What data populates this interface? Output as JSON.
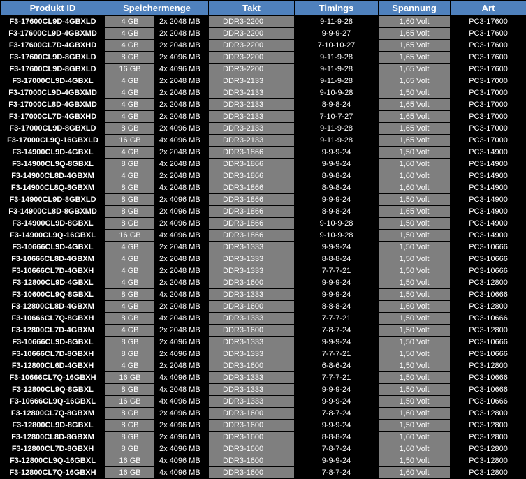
{
  "header": {
    "produkt_id": "Produkt ID",
    "speichermenge": "Speichermenge",
    "takt": "Takt",
    "timings": "Timings",
    "spannung": "Spannung",
    "art": "Art"
  },
  "rows": [
    [
      "F3-17600CL9D-4GBXLD",
      "4 GB",
      "2x 2048 MB",
      "DDR3-2200",
      "9-11-9-28",
      "1,60 Volt",
      "PC3-17600"
    ],
    [
      "F3-17600CL9D-4GBXMD",
      "4 GB",
      "2x 2048 MB",
      "DDR3-2200",
      "9-9-9-27",
      "1,65 Volt",
      "PC3-17600"
    ],
    [
      "F3-17600CL7D-4GBXHD",
      "4 GB",
      "2x 2048 MB",
      "DDR3-2200",
      "7-10-10-27",
      "1,65 Volt",
      "PC3-17600"
    ],
    [
      "F3-17600CL9D-8GBXLD",
      "8 GB",
      "2x 4096 MB",
      "DDR3-2200",
      "9-11-9-28",
      "1,65 Volt",
      "PC3-17600"
    ],
    [
      "F3-17600CL9D-8GBXLD",
      "16 GB",
      "4x 4096 MB",
      "DDR3-2200",
      "9-11-9-28",
      "1,65 Volt",
      "PC3-17600"
    ],
    [
      "F3-17000CL9D-4GBXL",
      "4 GB",
      "2x 2048 MB",
      "DDR3-2133",
      "9-11-9-28",
      "1,65 Volt",
      "PC3-17000"
    ],
    [
      "F3-17000CL9D-4GBXMD",
      "4 GB",
      "2x 2048 MB",
      "DDR3-2133",
      "9-10-9-28",
      "1,50 Volt",
      "PC3-17000"
    ],
    [
      "F3-17000CL8D-4GBXMD",
      "4 GB",
      "2x 2048 MB",
      "DDR3-2133",
      "8-9-8-24",
      "1,65 Volt",
      "PC3-17000"
    ],
    [
      "F3-17000CL7D-4GBXHD",
      "4 GB",
      "2x 2048 MB",
      "DDR3-2133",
      "7-10-7-27",
      "1,65 Volt",
      "PC3-17000"
    ],
    [
      "F3-17000CL9D-8GBXLD",
      "8 GB",
      "2x 4096 MB",
      "DDR3-2133",
      "9-11-9-28",
      "1,65 Volt",
      "PC3-17000"
    ],
    [
      "F3-17000CL9Q-16GBXLD",
      "16 GB",
      "4x 4096 MB",
      "DDR3-2133",
      "9-11-9-28",
      "1,65 Volt",
      "PC3-17000"
    ],
    [
      "F3-14900CL9D-4GBXL",
      "4 GB",
      "2x 2048 MB",
      "DDR3-1866",
      "9-9-9-24",
      "1,50 Volt",
      "PC3-14900"
    ],
    [
      "F3-14900CL9Q-8GBXL",
      "8 GB",
      "4x 2048 MB",
      "DDR3-1866",
      "9-9-9-24",
      "1,60 Volt",
      "PC3-14900"
    ],
    [
      "F3-14900CL8D-4GBXM",
      "4 GB",
      "2x 2048 MB",
      "DDR3-1866",
      "8-9-8-24",
      "1,60 Volt",
      "PC3-14900"
    ],
    [
      "F3-14900CL8Q-8GBXM",
      "8 GB",
      "4x 2048 MB",
      "DDR3-1866",
      "8-9-8-24",
      "1,60 Volt",
      "PC3-14900"
    ],
    [
      "F3-14900CL9D-8GBXLD",
      "8 GB",
      "2x 4096 MB",
      "DDR3-1866",
      "9-9-9-24",
      "1,50 Volt",
      "PC3-14900"
    ],
    [
      "F3-14900CL8D-8GBXMD",
      "8 GB",
      "2x 4096 MB",
      "DDR3-1866",
      "8-9-8-24",
      "1,65 Volt",
      "PC3-14900"
    ],
    [
      "F3-14900CL9D-8GBXL",
      "8 GB",
      "2x 4096 MB",
      "DDR3-1866",
      "9-10-9-28",
      "1,50 Volt",
      "PC3-14900"
    ],
    [
      "F3-14900CL9Q-16GBXL",
      "16 GB",
      "4x 4096 MB",
      "DDR3-1866",
      "9-10-9-28",
      "1,50 Volt",
      "PC3-14900"
    ],
    [
      "F3-10666CL9D-4GBXL",
      "4 GB",
      "2x 2048 MB",
      "DDR3-1333",
      "9-9-9-24",
      "1,50 Volt",
      "PC3-10666"
    ],
    [
      "F3-10666CL8D-4GBXM",
      "4 GB",
      "2x 2048 MB",
      "DDR3-1333",
      "8-8-8-24",
      "1,50 Volt",
      "PC3-10666"
    ],
    [
      "F3-10666CL7D-4GBXH",
      "4 GB",
      "2x 2048 MB",
      "DDR3-1333",
      "7-7-7-21",
      "1,50 Volt",
      "PC3-10666"
    ],
    [
      "F3-12800CL9D-4GBXL",
      "4 GB",
      "2x 2048 MB",
      "DDR3-1600",
      "9-9-9-24",
      "1,50 Volt",
      "PC3-12800"
    ],
    [
      "F3-10600CL9Q-8GBXL",
      "8 GB",
      "4x 2048 MB",
      "DDR3-1333",
      "9-9-9-24",
      "1,50 Volt",
      "PC3-10666"
    ],
    [
      "F3-12800CL8D-4GBXM",
      "4 GB",
      "2x 2048 MB",
      "DDR3-1600",
      "8-8-8-24",
      "1,60 Volt",
      "PC3-12800"
    ],
    [
      "F3-10666CL7Q-8GBXH",
      "8 GB",
      "4x 2048 MB",
      "DDR3-1333",
      "7-7-7-21",
      "1,50 Volt",
      "PC3-10666"
    ],
    [
      "F3-12800CL7D-4GBXM",
      "4 GB",
      "2x 2048 MB",
      "DDR3-1600",
      "7-8-7-24",
      "1,50 Volt",
      "PC3-12800"
    ],
    [
      "F3-10666CL9D-8GBXL",
      "8 GB",
      "2x 4096 MB",
      "DDR3-1333",
      "9-9-9-24",
      "1,50 Volt",
      "PC3-10666"
    ],
    [
      "F3-10666CL7D-8GBXH",
      "8 GB",
      "2x 4096 MB",
      "DDR3-1333",
      "7-7-7-21",
      "1,50 Volt",
      "PC3-10666"
    ],
    [
      "F3-12800CL6D-4GBXH",
      "4 GB",
      "2x 2048 MB",
      "DDR3-1600",
      "6-8-6-24",
      "1,50 Volt",
      "PC3-12800"
    ],
    [
      "F3-10666CL7Q-16GBXH",
      "16 GB",
      "4x 4096 MB",
      "DDR3-1333",
      "7-7-7-21",
      "1,50 Volt",
      "PC3-10666"
    ],
    [
      "F3-12800CL9Q-8GBXL",
      "8 GB",
      "4x 2048 MB",
      "DDR3-1333",
      "9-9-9-24",
      "1,50 Volt",
      "PC3-10666"
    ],
    [
      "F3-10666CL9Q-16GBXL",
      "16 GB",
      "4x 4096 MB",
      "DDR3-1333",
      "9-9-9-24",
      "1,50 Volt",
      "PC3-10666"
    ],
    [
      "F3-12800CL7Q-8GBXM",
      "8 GB",
      "2x 4096 MB",
      "DDR3-1600",
      "7-8-7-24",
      "1,60 Volt",
      "PC3-12800"
    ],
    [
      "F3-12800CL9D-8GBXL",
      "8 GB",
      "2x 4096 MB",
      "DDR3-1600",
      "9-9-9-24",
      "1,50 Volt",
      "PC3-12800"
    ],
    [
      "F3-12800CL8D-8GBXM",
      "8 GB",
      "2x 4096 MB",
      "DDR3-1600",
      "8-8-8-24",
      "1,60 Volt",
      "PC3-12800"
    ],
    [
      "F3-12800CL7D-8GBXH",
      "8 GB",
      "2x 4096 MB",
      "DDR3-1600",
      "7-8-7-24",
      "1,60 Volt",
      "PC3-12800"
    ],
    [
      "F3-12800CL9Q-16GBXL",
      "16 GB",
      "4x 4096 MB",
      "DDR3-1600",
      "9-9-9-24",
      "1,50 Volt",
      "PC3-12800"
    ],
    [
      "F3-12800CL7Q-16GBXH",
      "16 GB",
      "4x 4096 MB",
      "DDR3-1600",
      "7-8-7-24",
      "1,60 Volt",
      "PC3-12800"
    ]
  ]
}
